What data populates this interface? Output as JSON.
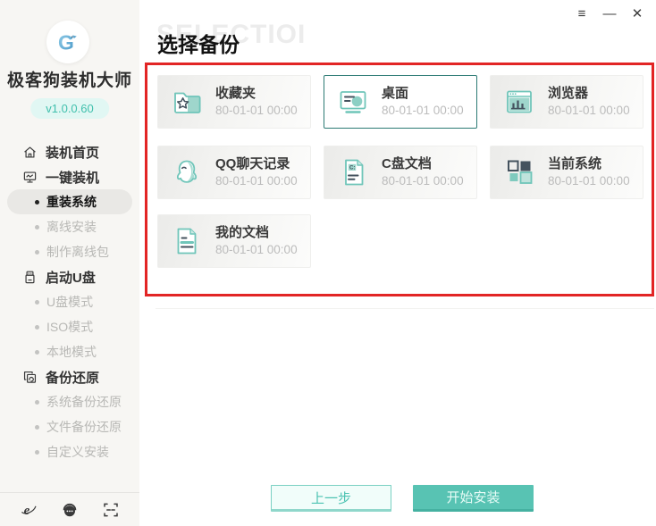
{
  "colors": {
    "accent_teal": "#58c3b3",
    "accent_teal_dark": "#2c7a74",
    "highlight_red": "#e22525",
    "version_badge_bg": "#e1f7f3",
    "version_badge_text": "#41c0ad",
    "sidebar_bg": "#f7f6f3",
    "muted_text": "#b8b8b5"
  },
  "window_controls": [
    {
      "key": "menu",
      "glyph": "≡"
    },
    {
      "key": "minimize",
      "glyph": "—"
    },
    {
      "key": "close",
      "glyph": "✕"
    }
  ],
  "sidebar": {
    "logo_icon": "geekdog-logo-icon",
    "app_name": "极客狗装机大师",
    "version_badge": "v1.0.0.60",
    "menu": [
      {
        "key": "home",
        "label": "装机首页",
        "type": "top",
        "icon": "home-icon"
      },
      {
        "key": "one-click-install",
        "label": "一键装机",
        "type": "top",
        "icon": "monitor-icon"
      },
      {
        "key": "reinstall-system",
        "label": "重装系统",
        "type": "sub",
        "active": true
      },
      {
        "key": "offline-install",
        "label": "离线安装",
        "type": "sub"
      },
      {
        "key": "make-offline-pack",
        "label": "制作离线包",
        "type": "sub"
      },
      {
        "key": "boot-usb",
        "label": "启动U盘",
        "type": "top",
        "icon": "usb-icon"
      },
      {
        "key": "usb-mode",
        "label": "U盘模式",
        "type": "sub"
      },
      {
        "key": "iso-mode",
        "label": "ISO模式",
        "type": "sub"
      },
      {
        "key": "local-mode",
        "label": "本地模式",
        "type": "sub"
      },
      {
        "key": "backup-restore",
        "label": "备份还原",
        "type": "top",
        "icon": "restore-icon"
      },
      {
        "key": "system-backup-restore",
        "label": "系统备份还原",
        "type": "sub"
      },
      {
        "key": "file-backup-restore",
        "label": "文件备份还原",
        "type": "sub"
      },
      {
        "key": "custom-install",
        "label": "自定义安装",
        "type": "sub"
      }
    ],
    "footer_icons": [
      "ie-icon",
      "support-headset-icon",
      "scan-icon"
    ]
  },
  "main": {
    "watermark": "SELECTIOI",
    "page_title": "选择备份",
    "backups": [
      {
        "key": "favorites",
        "name": "收藏夹",
        "time": "80-01-01 00:00",
        "icon": "favorites-folder-icon",
        "selected": false
      },
      {
        "key": "desktop",
        "name": "桌面",
        "time": "80-01-01 00:00",
        "icon": "desktop-icon",
        "selected": true
      },
      {
        "key": "browser",
        "name": "浏览器",
        "time": "80-01-01 00:00",
        "icon": "browser-window-icon",
        "selected": false
      },
      {
        "key": "qq-chat",
        "name": "QQ聊天记录",
        "time": "80-01-01 00:00",
        "icon": "qq-icon",
        "selected": false
      },
      {
        "key": "c-drive-docs",
        "name": "C盘文档",
        "time": "80-01-01 00:00",
        "icon": "c-drive-doc-icon",
        "selected": false
      },
      {
        "key": "current-system",
        "name": "当前系统",
        "time": "80-01-01 00:00",
        "icon": "system-grid-icon",
        "selected": false
      },
      {
        "key": "my-documents",
        "name": "我的文档",
        "time": "80-01-01 00:00",
        "icon": "my-documents-icon",
        "selected": false
      }
    ],
    "footer_buttons": {
      "prev": "上一步",
      "start": "开始安装"
    }
  }
}
